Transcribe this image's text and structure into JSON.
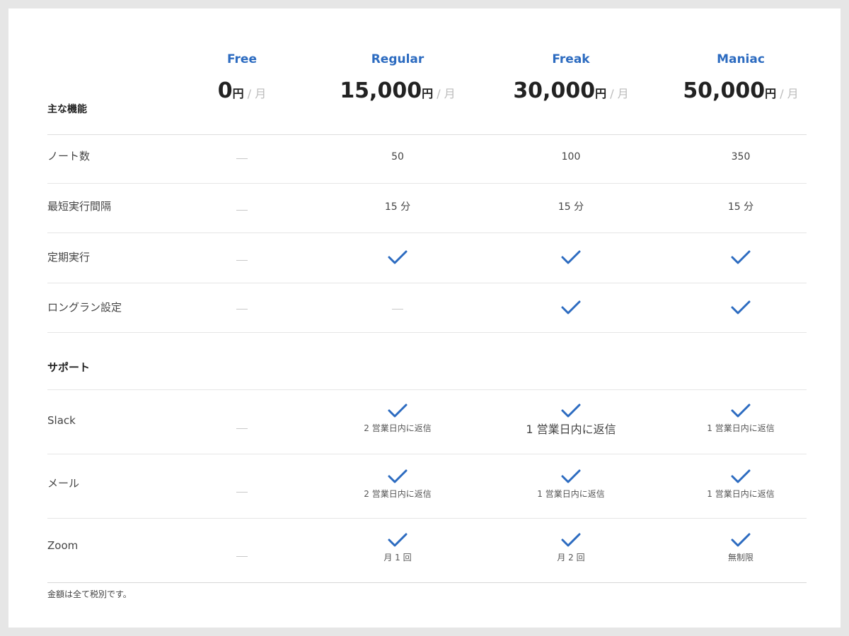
{
  "header": {
    "feature_label": "主な機能",
    "plans": [
      {
        "name": "Free",
        "amount": "0",
        "yen": "円",
        "per": " / 月"
      },
      {
        "name": "Regular",
        "amount": "15,000",
        "yen": "円",
        "per": " / 月"
      },
      {
        "name": "Freak",
        "amount": "30,000",
        "yen": "円",
        "per": " / 月"
      },
      {
        "name": "Maniac",
        "amount": "50,000",
        "yen": "円",
        "per": " / 月"
      }
    ]
  },
  "features": {
    "notes": {
      "label": "ノート数",
      "regular": "50",
      "freak": "100",
      "maniac": "350"
    },
    "interval": {
      "label": "最短実行間隔",
      "regular": "15 分",
      "freak": "15 分",
      "maniac": "15 分"
    },
    "scheduled": {
      "label": "定期実行"
    },
    "longrun": {
      "label": "ロングラン設定"
    }
  },
  "support": {
    "label": "サポート",
    "slack": {
      "label": "Slack",
      "regular": "2 営業日内に返信",
      "freak": "1 営業日内に返信",
      "maniac": "1 営業日内に返信"
    },
    "mail": {
      "label": "メール",
      "regular": "2 営業日内に返信",
      "freak": "1 営業日内に返信",
      "maniac": "1 営業日内に返信"
    },
    "zoom": {
      "label": "Zoom",
      "regular": "月 1 回",
      "freak": "月 2 回",
      "maniac": "無制限"
    }
  },
  "footnote": "金額は全て税別です。",
  "colors": {
    "accent": "#2c6bc0",
    "check": "#2c6bc0"
  },
  "icons": {
    "included": "check-icon",
    "not_included": "dash-icon"
  }
}
